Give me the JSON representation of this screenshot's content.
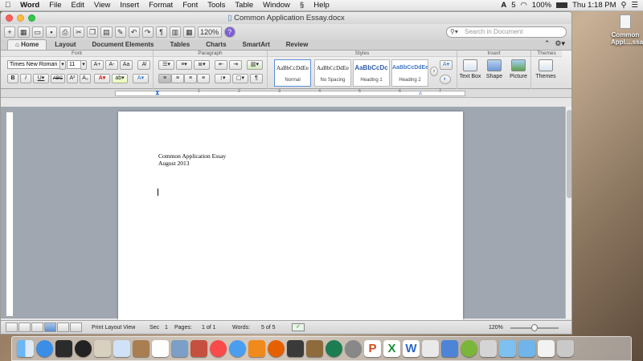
{
  "menubar": {
    "app": "Word",
    "items": [
      "File",
      "Edit",
      "View",
      "Insert",
      "Format",
      "Font",
      "Tools",
      "Table",
      "Window",
      "Help"
    ],
    "right": {
      "status_a": "5",
      "battery": "100%",
      "clock": "Thu 1:18 PM"
    }
  },
  "window": {
    "title": "Common Application Essay.docx"
  },
  "toolbar": {
    "zoom": "120%",
    "search_placeholder": "Search in Document"
  },
  "ribbon": {
    "tabs": [
      "Home",
      "Layout",
      "Document Elements",
      "Tables",
      "Charts",
      "SmartArt",
      "Review"
    ],
    "groups": {
      "font": "Font",
      "paragraph": "Paragraph",
      "styles": "Styles",
      "insert": "Insert",
      "themes": "Themes"
    },
    "font_name": "Times New Roman",
    "font_size": "11",
    "styles": [
      {
        "preview": "AaBbCcDdEe",
        "name": "Normal"
      },
      {
        "preview": "AaBbCcDdEe",
        "name": "No Spacing"
      },
      {
        "preview": "AaBbCcDc",
        "name": "Heading 1"
      },
      {
        "preview": "AaBbCcDdEe",
        "name": "Heading 2"
      }
    ],
    "insert_buttons": [
      "Text Box",
      "Shape",
      "Picture"
    ],
    "themes_button": "Themes"
  },
  "ruler": {
    "ticks": [
      "1",
      "2",
      "3",
      "4",
      "5",
      "6",
      "7"
    ]
  },
  "document": {
    "line1": "Common Application Essay",
    "line2": "August 2013"
  },
  "status": {
    "view": "Print Layout View",
    "sec_label": "Sec",
    "sec_value": "1",
    "pages_label": "Pages:",
    "pages_value": "1 of 1",
    "words_label": "Words:",
    "words_value": "5 of 5",
    "zoom": "120%"
  },
  "desktop": {
    "file_label": "Common Appl....ssay"
  },
  "colors": {
    "accent": "#3b78d6",
    "ribbon": "#e6e6e6",
    "desk_bg": "#a0a7b0"
  }
}
